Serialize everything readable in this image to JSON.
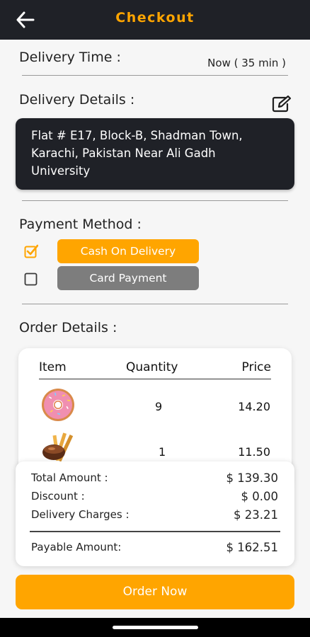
{
  "header": {
    "title": "Checkout",
    "back_icon": "arrow-left-icon"
  },
  "delivery_time": {
    "label": "Delivery Time :",
    "value": "Now ( 35 min )"
  },
  "delivery_details": {
    "label": "Delivery Details :",
    "address_line1": "Flat # E17, Block-B, Shadman Town,",
    "address_line2": "Karachi, Pakistan Near Ali Gadh",
    "address_line3": "University",
    "edit_icon": "edit-icon"
  },
  "payment": {
    "label": "Payment Method :",
    "options": [
      {
        "label": "Cash On Delivery",
        "checked": true
      },
      {
        "label": "Card Payment",
        "checked": false
      }
    ]
  },
  "order_details": {
    "label": "Order Details :",
    "columns": [
      "Item",
      "Quantity",
      "Price"
    ],
    "rows": [
      {
        "image": "donut-icon",
        "quantity": "9",
        "price": "14.20"
      },
      {
        "image": "fries-icon",
        "quantity": "1",
        "price": "11.50"
      }
    ]
  },
  "summary": {
    "total_label": "Total Amount :",
    "total_value": "$ 139.30",
    "discount_label": "Discount :",
    "discount_value": "$ 0.00",
    "delivery_label": "Delivery Charges :",
    "delivery_value": "$ 23.21",
    "payable_label": "Payable Amount:",
    "payable_value": "$ 162.51"
  },
  "order_button": {
    "label": "Order Now"
  },
  "colors": {
    "accent": "#FFA500",
    "dark": "#1F2127",
    "grey": "#7D7D7D"
  }
}
